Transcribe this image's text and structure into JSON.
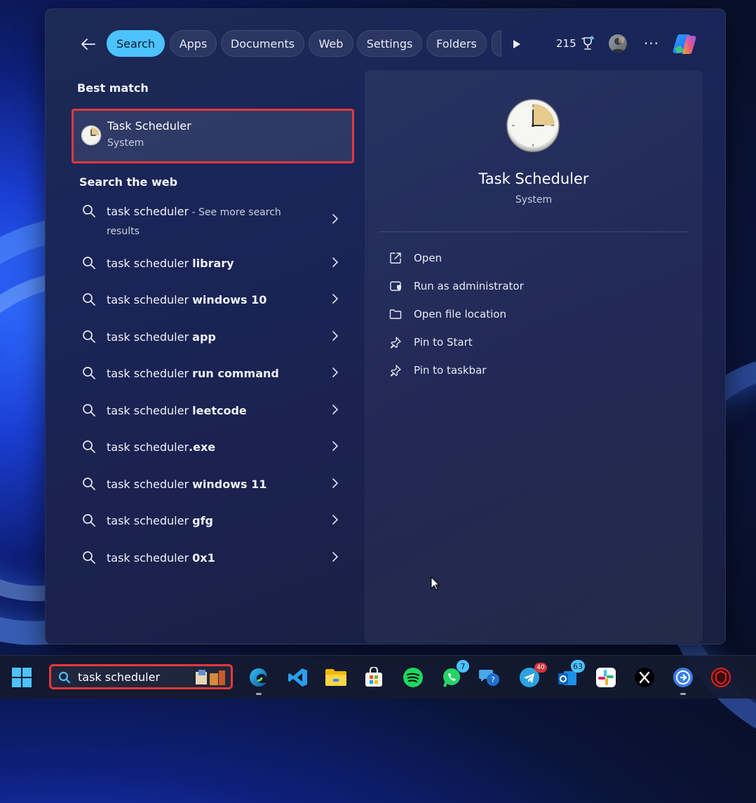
{
  "filter_bar": {
    "tabs": [
      {
        "label": "Search",
        "active": true
      },
      {
        "label": "Apps",
        "active": false
      },
      {
        "label": "Documents",
        "active": false
      },
      {
        "label": "Web",
        "active": false
      },
      {
        "label": "Settings",
        "active": false
      },
      {
        "label": "Folders",
        "active": false
      }
    ],
    "points": "215",
    "accent_color": "#4cc2ff"
  },
  "best_match": {
    "heading": "Best match",
    "title": "Task Scheduler",
    "subtitle": "System"
  },
  "web": {
    "heading": "Search the web",
    "items": [
      {
        "prefix": "task scheduler",
        "bold": "",
        "suffix": " - See more search",
        "line2": "results"
      },
      {
        "prefix": "task scheduler ",
        "bold": "library",
        "suffix": "",
        "line2": ""
      },
      {
        "prefix": "task scheduler ",
        "bold": "windows 10",
        "suffix": "",
        "line2": ""
      },
      {
        "prefix": "task scheduler ",
        "bold": "app",
        "suffix": "",
        "line2": ""
      },
      {
        "prefix": "task scheduler ",
        "bold": "run command",
        "suffix": "",
        "line2": ""
      },
      {
        "prefix": "task scheduler ",
        "bold": "leetcode",
        "suffix": "",
        "line2": ""
      },
      {
        "prefix": "task scheduler",
        "bold": ".exe",
        "suffix": "",
        "line2": ""
      },
      {
        "prefix": "task scheduler ",
        "bold": "windows 11",
        "suffix": "",
        "line2": ""
      },
      {
        "prefix": "task scheduler ",
        "bold": "gfg",
        "suffix": "",
        "line2": ""
      },
      {
        "prefix": "task scheduler ",
        "bold": "0x1",
        "suffix": "",
        "line2": ""
      }
    ]
  },
  "details": {
    "title": "Task Scheduler",
    "subtitle": "System",
    "actions": [
      {
        "label": "Open",
        "icon": "open-external-icon"
      },
      {
        "label": "Run as administrator",
        "icon": "shield-icon"
      },
      {
        "label": "Open file location",
        "icon": "folder-icon"
      },
      {
        "label": "Pin to Start",
        "icon": "pin-icon"
      },
      {
        "label": "Pin to taskbar",
        "icon": "pin-icon"
      }
    ]
  },
  "taskbar": {
    "search_text": "task scheduler",
    "apps": [
      {
        "name": "edge",
        "badge": ""
      },
      {
        "name": "vscode",
        "badge": ""
      },
      {
        "name": "file-explorer",
        "badge": ""
      },
      {
        "name": "microsoft-store",
        "badge": ""
      },
      {
        "name": "spotify",
        "badge": ""
      },
      {
        "name": "whatsapp",
        "badge": "7"
      },
      {
        "name": "feedback-hub",
        "badge": ""
      },
      {
        "name": "telegram",
        "badge": "40"
      },
      {
        "name": "outlook",
        "badge": "63"
      },
      {
        "name": "slack",
        "badge": ""
      },
      {
        "name": "x",
        "badge": ""
      },
      {
        "name": "sync-app",
        "badge": ""
      },
      {
        "name": "security-app",
        "badge": ""
      }
    ]
  }
}
